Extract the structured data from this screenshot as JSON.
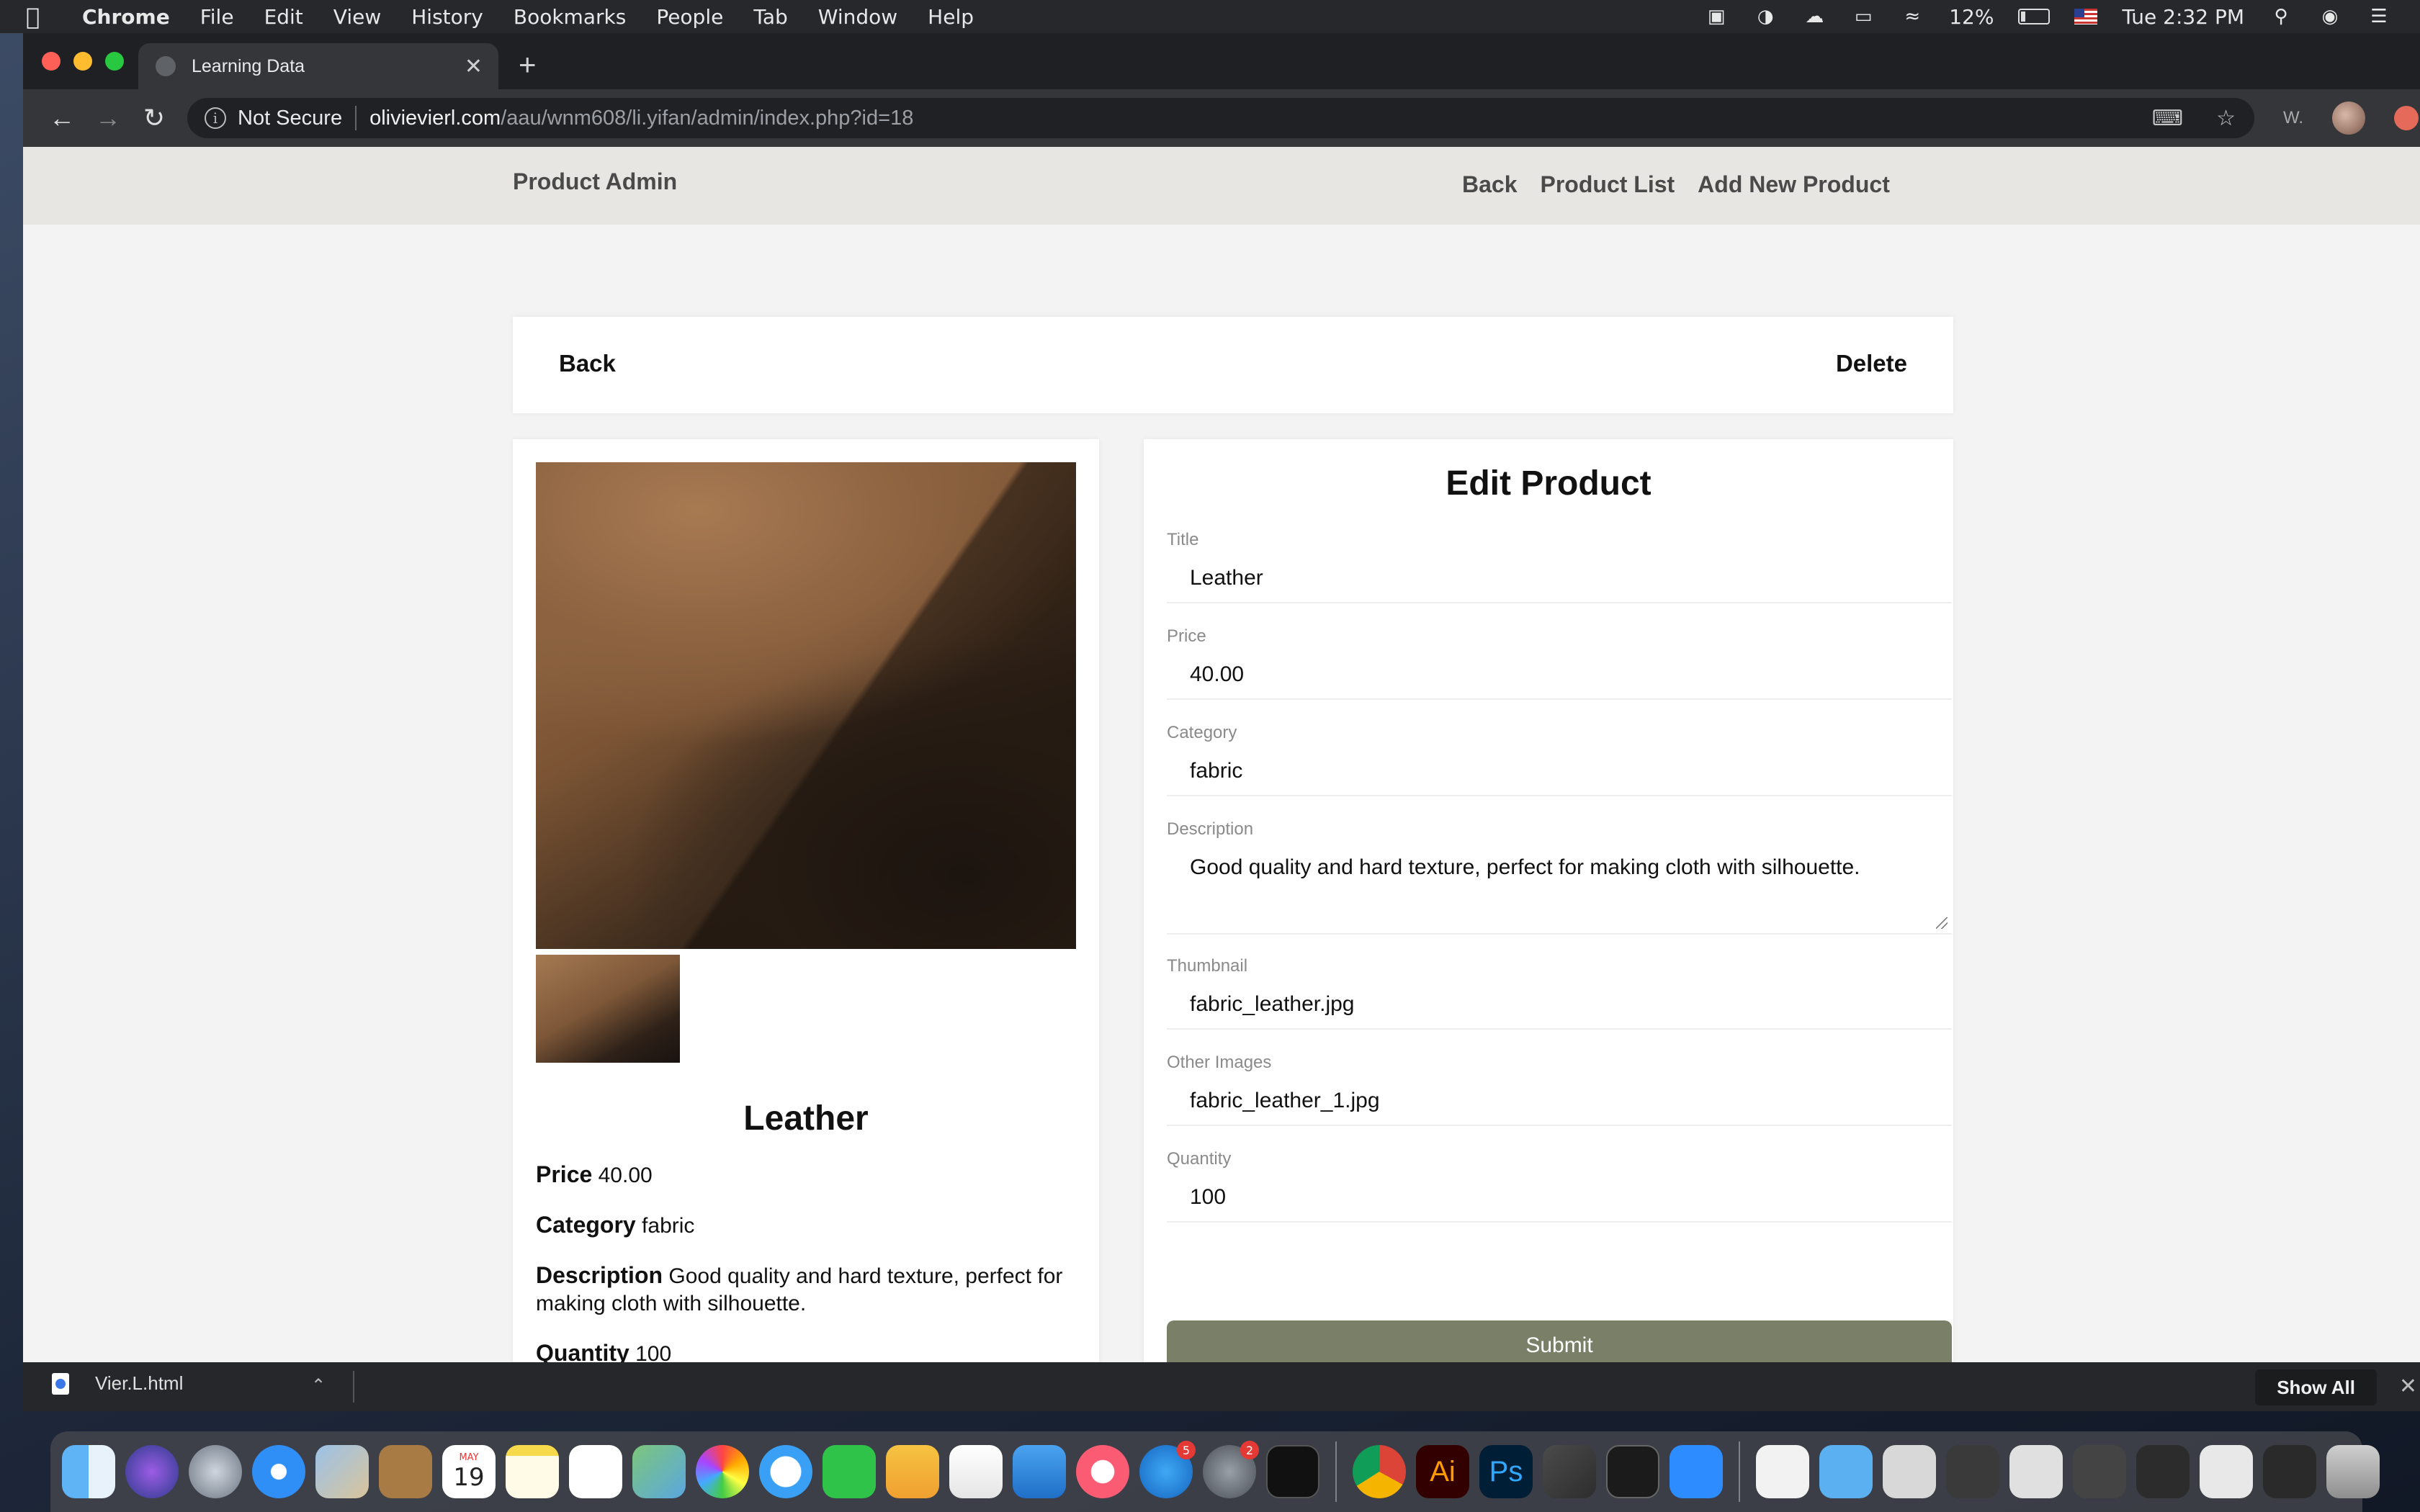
{
  "menubar": {
    "app_name": "Chrome",
    "items": [
      "File",
      "Edit",
      "View",
      "History",
      "Bookmarks",
      "People",
      "Tab",
      "Window",
      "Help"
    ],
    "battery": "12%",
    "clock": "Tue 2:32 PM"
  },
  "browser": {
    "tab_title": "Learning Data",
    "security_label": "Not Secure",
    "url_host": "olivievierl.com",
    "url_path": "/aau/wnm608/li.yifan/admin/index.php?id=18",
    "ext_w": "W."
  },
  "site": {
    "brand": "Product Admin",
    "nav_links": [
      "Back",
      "Product List",
      "Add New Product"
    ]
  },
  "toolbar_card": {
    "back_label": "Back",
    "delete_label": "Delete"
  },
  "product": {
    "title": "Leather",
    "price_label": "Price",
    "price": "40.00",
    "category_label": "Category",
    "category": "fabric",
    "description_label": "Description",
    "description": "Good quality and hard texture, perfect for making cloth with silhouette.",
    "quantity_label": "Quantity",
    "quantity": "100"
  },
  "form": {
    "heading": "Edit Product",
    "fields": {
      "title": {
        "label": "Title",
        "value": "Leather"
      },
      "price": {
        "label": "Price",
        "value": "40.00"
      },
      "category": {
        "label": "Category",
        "value": "fabric"
      },
      "description": {
        "label": "Description",
        "value": "Good quality and hard texture, perfect for making cloth with silhouette."
      },
      "thumbnail": {
        "label": "Thumbnail",
        "value": "fabric_leather.jpg"
      },
      "other_images": {
        "label": "Other Images",
        "value": "fabric_leather_1.jpg"
      },
      "quantity": {
        "label": "Quantity",
        "value": "100"
      }
    },
    "submit_label": "Submit"
  },
  "downloads": {
    "file_name": "Vier.L.html",
    "show_all_label": "Show All"
  },
  "dock": {
    "calendar_month": "MAY",
    "calendar_day": "19",
    "appstore_badge": "5",
    "settings_badge": "2",
    "illustrator_label": "Ai",
    "photoshop_label": "Ps"
  },
  "colors": {
    "submit_bg": "#7a8068",
    "nav_bg": "#e8e6e3",
    "page_bg": "#f3f3f3"
  }
}
